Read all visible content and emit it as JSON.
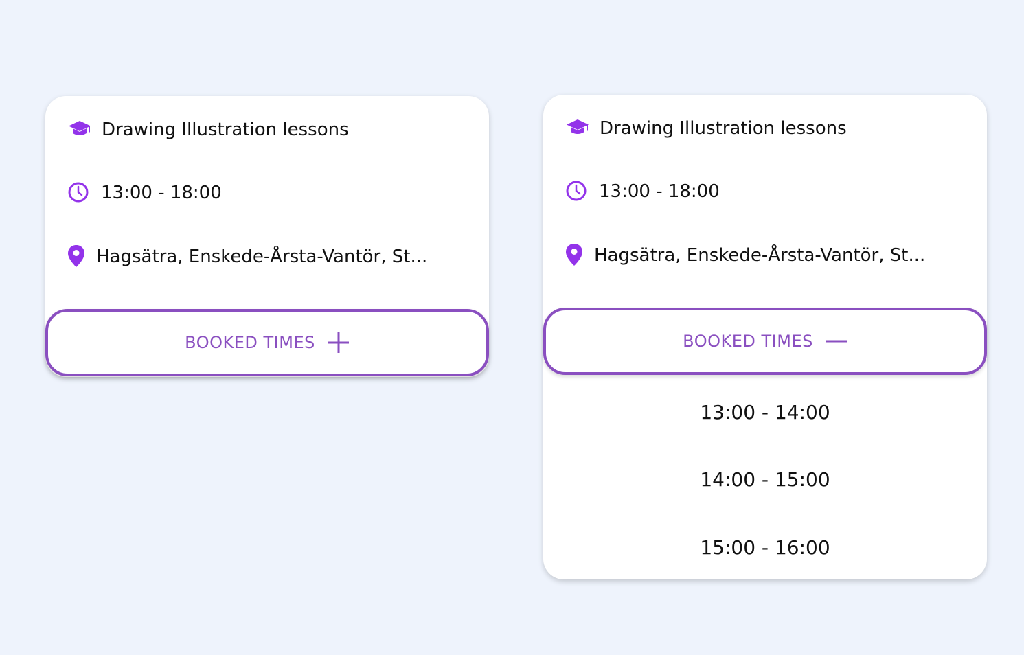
{
  "accent_color": "#8a4fc0",
  "icon_color": "#9333ea",
  "cards": [
    {
      "state": "collapsed",
      "title": "Drawing Illustration lessons",
      "title_icon": "graduation-cap-icon",
      "time": "13:00 - 18:00",
      "time_icon": "clock-icon",
      "location": "Hagsätra, Enskede-Årsta-Vantör, St...",
      "location_icon": "map-pin-icon",
      "booked_label": "BOOKED TIMES",
      "toggle_icon": "plus-icon",
      "slots": []
    },
    {
      "state": "expanded",
      "title": "Drawing Illustration lessons",
      "title_icon": "graduation-cap-icon",
      "time": "13:00 - 18:00",
      "time_icon": "clock-icon",
      "location": "Hagsätra, Enskede-Årsta-Vantör, St...",
      "location_icon": "map-pin-icon",
      "booked_label": "BOOKED TIMES",
      "toggle_icon": "minus-icon",
      "slots": [
        "13:00 - 14:00",
        "14:00 - 15:00",
        "15:00 - 16:00"
      ]
    }
  ]
}
